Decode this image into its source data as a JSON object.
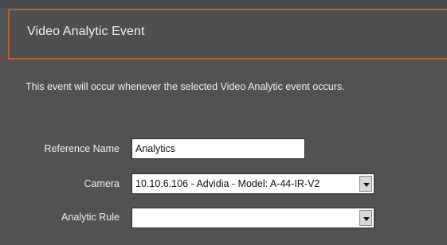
{
  "panel": {
    "title": "Video Analytic Event",
    "description": "This event will occur whenever the selected Video Analytic event occurs."
  },
  "form": {
    "reference_name": {
      "label": "Reference Name",
      "value": "Analytics"
    },
    "camera": {
      "label": "Camera",
      "selected": "10.10.6.106 - Advidia - Model: A-44-IR-V2",
      "icon": "chevron-down-icon"
    },
    "analytic_rule": {
      "label": "Analytic Rule",
      "selected": "",
      "icon": "chevron-down-icon"
    }
  },
  "colors": {
    "panel_background": "#525252",
    "header_border": "#b5622b",
    "text": "#f0f0f0"
  }
}
